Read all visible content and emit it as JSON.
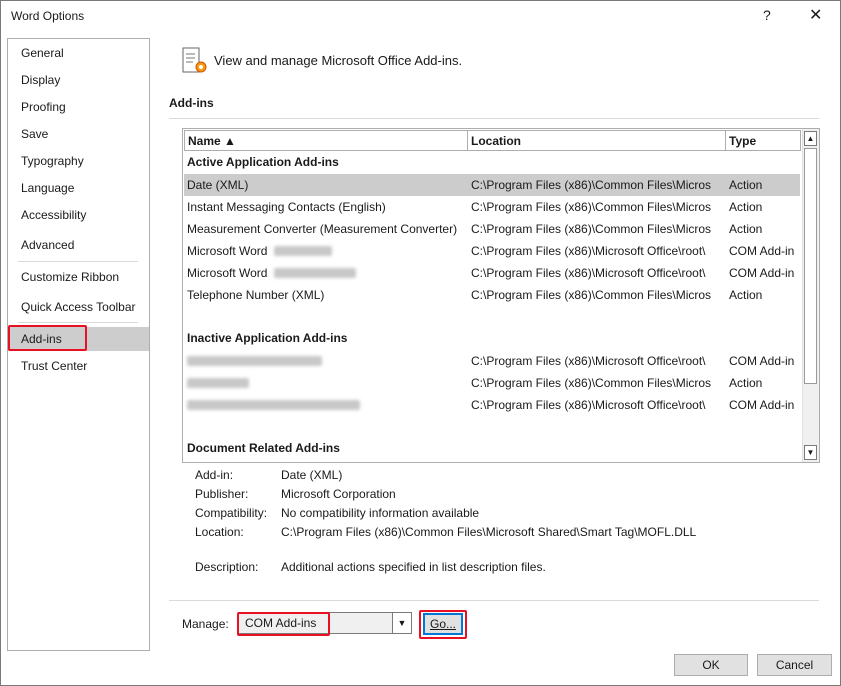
{
  "window": {
    "title": "Word Options",
    "help_glyph": "?",
    "close_glyph": "✕"
  },
  "nav": {
    "items": [
      {
        "label": "General"
      },
      {
        "label": "Display"
      },
      {
        "label": "Proofing"
      },
      {
        "label": "Save"
      },
      {
        "label": "Typography"
      },
      {
        "label": "Language"
      },
      {
        "label": "Accessibility"
      },
      {
        "label": "Advanced"
      },
      {
        "label": "Customize Ribbon"
      },
      {
        "label": "Quick Access Toolbar"
      },
      {
        "label": "Add-ins"
      },
      {
        "label": "Trust Center"
      }
    ],
    "selected": "Add-ins"
  },
  "header": {
    "text": "View and manage Microsoft Office Add-ins.",
    "icon": "addins-gear-icon"
  },
  "section": {
    "title": "Add-ins"
  },
  "table": {
    "columns": [
      "Name ▲",
      "Location",
      "Type"
    ],
    "groups": [
      {
        "title": "Active Application Add-ins",
        "rows": [
          {
            "name": "Date (XML)",
            "location": "C:\\Program Files (x86)\\Common Files\\Micros",
            "type": "Action"
          },
          {
            "name": "Instant Messaging Contacts (English)",
            "location": "C:\\Program Files (x86)\\Common Files\\Micros",
            "type": "Action"
          },
          {
            "name": "Measurement Converter (Measurement Converter)",
            "location": "C:\\Program Files (x86)\\Common Files\\Micros",
            "type": "Action"
          },
          {
            "name": "Microsoft Word",
            "location": "C:\\Program Files (x86)\\Microsoft Office\\root\\",
            "type": "COM Add-in"
          },
          {
            "name": "Microsoft Word",
            "location": "C:\\Program Files (x86)\\Microsoft Office\\root\\",
            "type": "COM Add-in"
          },
          {
            "name": "Telephone Number (XML)",
            "location": "C:\\Program Files (x86)\\Common Files\\Micros",
            "type": "Action"
          }
        ]
      },
      {
        "title": "Inactive Application Add-ins",
        "rows": [
          {
            "name": "",
            "location": "C:\\Program Files (x86)\\Microsoft Office\\root\\",
            "type": "COM Add-in"
          },
          {
            "name": "",
            "location": "C:\\Program Files (x86)\\Common Files\\Micros",
            "type": "Action"
          },
          {
            "name": "",
            "location": "C:\\Program Files (x86)\\Microsoft Office\\root\\",
            "type": "COM Add-in"
          }
        ]
      },
      {
        "title": "Document Related Add-ins",
        "rows": []
      }
    ]
  },
  "details": {
    "addin_label": "Add-in:",
    "addin_value": "Date (XML)",
    "publisher_label": "Publisher:",
    "publisher_value": "Microsoft Corporation",
    "compat_label": "Compatibility:",
    "compat_value": "No compatibility information available",
    "location_label": "Location:",
    "location_value": "C:\\Program Files (x86)\\Common Files\\Microsoft Shared\\Smart Tag\\MOFL.DLL",
    "desc_label": "Description:",
    "desc_value": "Additional actions specified in list description files."
  },
  "manage": {
    "label": "Manage:",
    "selected": "COM Add-ins",
    "go_label": "Go..."
  },
  "footer": {
    "ok_label": "OK",
    "cancel_label": "Cancel"
  },
  "colors": {
    "highlight_red": "#e81123",
    "selected_bg": "#cdcdcd"
  }
}
